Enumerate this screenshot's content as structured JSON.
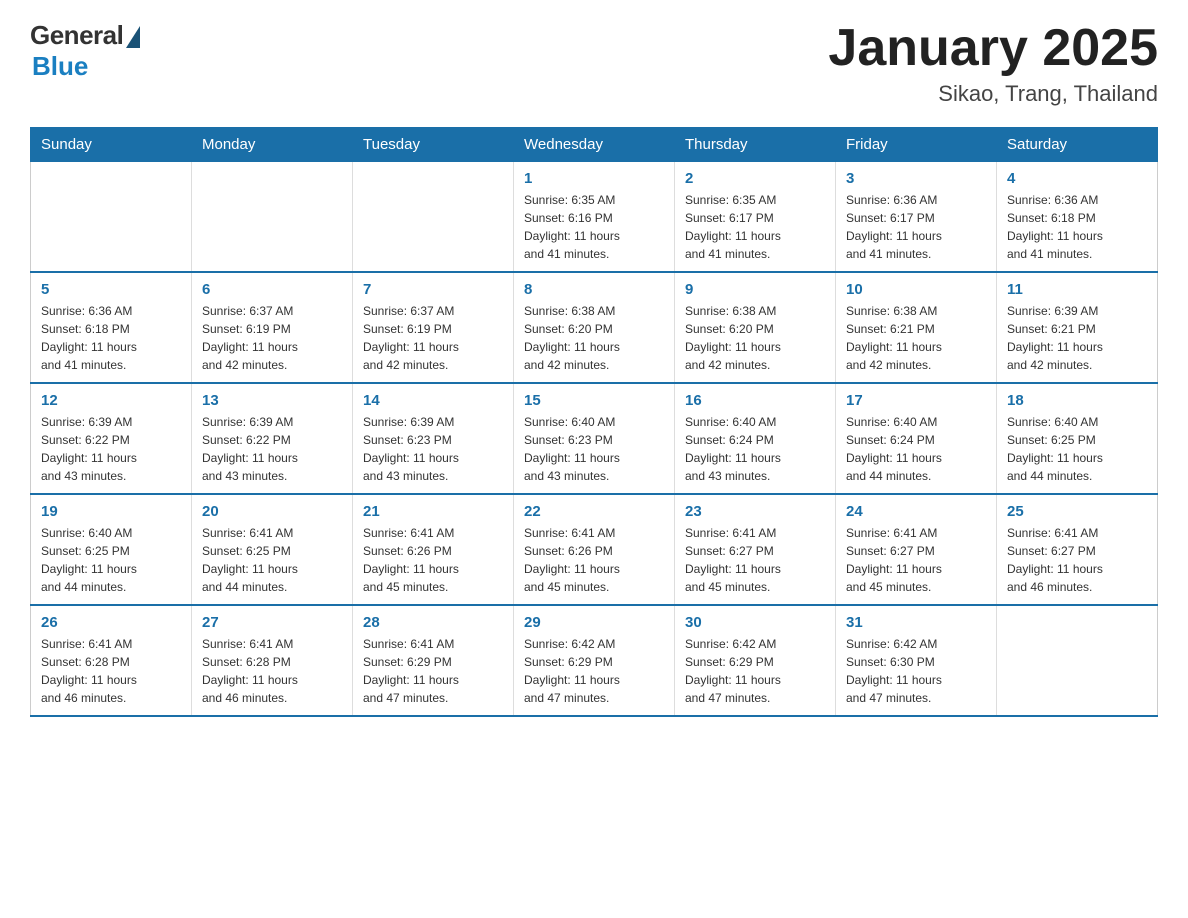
{
  "logo": {
    "general_text": "General",
    "blue_text": "Blue"
  },
  "title": {
    "month_year": "January 2025",
    "location": "Sikao, Trang, Thailand"
  },
  "days_of_week": [
    "Sunday",
    "Monday",
    "Tuesday",
    "Wednesday",
    "Thursday",
    "Friday",
    "Saturday"
  ],
  "weeks": [
    [
      {
        "day": "",
        "info": ""
      },
      {
        "day": "",
        "info": ""
      },
      {
        "day": "",
        "info": ""
      },
      {
        "day": "1",
        "info": "Sunrise: 6:35 AM\nSunset: 6:16 PM\nDaylight: 11 hours\nand 41 minutes."
      },
      {
        "day": "2",
        "info": "Sunrise: 6:35 AM\nSunset: 6:17 PM\nDaylight: 11 hours\nand 41 minutes."
      },
      {
        "day": "3",
        "info": "Sunrise: 6:36 AM\nSunset: 6:17 PM\nDaylight: 11 hours\nand 41 minutes."
      },
      {
        "day": "4",
        "info": "Sunrise: 6:36 AM\nSunset: 6:18 PM\nDaylight: 11 hours\nand 41 minutes."
      }
    ],
    [
      {
        "day": "5",
        "info": "Sunrise: 6:36 AM\nSunset: 6:18 PM\nDaylight: 11 hours\nand 41 minutes."
      },
      {
        "day": "6",
        "info": "Sunrise: 6:37 AM\nSunset: 6:19 PM\nDaylight: 11 hours\nand 42 minutes."
      },
      {
        "day": "7",
        "info": "Sunrise: 6:37 AM\nSunset: 6:19 PM\nDaylight: 11 hours\nand 42 minutes."
      },
      {
        "day": "8",
        "info": "Sunrise: 6:38 AM\nSunset: 6:20 PM\nDaylight: 11 hours\nand 42 minutes."
      },
      {
        "day": "9",
        "info": "Sunrise: 6:38 AM\nSunset: 6:20 PM\nDaylight: 11 hours\nand 42 minutes."
      },
      {
        "day": "10",
        "info": "Sunrise: 6:38 AM\nSunset: 6:21 PM\nDaylight: 11 hours\nand 42 minutes."
      },
      {
        "day": "11",
        "info": "Sunrise: 6:39 AM\nSunset: 6:21 PM\nDaylight: 11 hours\nand 42 minutes."
      }
    ],
    [
      {
        "day": "12",
        "info": "Sunrise: 6:39 AM\nSunset: 6:22 PM\nDaylight: 11 hours\nand 43 minutes."
      },
      {
        "day": "13",
        "info": "Sunrise: 6:39 AM\nSunset: 6:22 PM\nDaylight: 11 hours\nand 43 minutes."
      },
      {
        "day": "14",
        "info": "Sunrise: 6:39 AM\nSunset: 6:23 PM\nDaylight: 11 hours\nand 43 minutes."
      },
      {
        "day": "15",
        "info": "Sunrise: 6:40 AM\nSunset: 6:23 PM\nDaylight: 11 hours\nand 43 minutes."
      },
      {
        "day": "16",
        "info": "Sunrise: 6:40 AM\nSunset: 6:24 PM\nDaylight: 11 hours\nand 43 minutes."
      },
      {
        "day": "17",
        "info": "Sunrise: 6:40 AM\nSunset: 6:24 PM\nDaylight: 11 hours\nand 44 minutes."
      },
      {
        "day": "18",
        "info": "Sunrise: 6:40 AM\nSunset: 6:25 PM\nDaylight: 11 hours\nand 44 minutes."
      }
    ],
    [
      {
        "day": "19",
        "info": "Sunrise: 6:40 AM\nSunset: 6:25 PM\nDaylight: 11 hours\nand 44 minutes."
      },
      {
        "day": "20",
        "info": "Sunrise: 6:41 AM\nSunset: 6:25 PM\nDaylight: 11 hours\nand 44 minutes."
      },
      {
        "day": "21",
        "info": "Sunrise: 6:41 AM\nSunset: 6:26 PM\nDaylight: 11 hours\nand 45 minutes."
      },
      {
        "day": "22",
        "info": "Sunrise: 6:41 AM\nSunset: 6:26 PM\nDaylight: 11 hours\nand 45 minutes."
      },
      {
        "day": "23",
        "info": "Sunrise: 6:41 AM\nSunset: 6:27 PM\nDaylight: 11 hours\nand 45 minutes."
      },
      {
        "day": "24",
        "info": "Sunrise: 6:41 AM\nSunset: 6:27 PM\nDaylight: 11 hours\nand 45 minutes."
      },
      {
        "day": "25",
        "info": "Sunrise: 6:41 AM\nSunset: 6:27 PM\nDaylight: 11 hours\nand 46 minutes."
      }
    ],
    [
      {
        "day": "26",
        "info": "Sunrise: 6:41 AM\nSunset: 6:28 PM\nDaylight: 11 hours\nand 46 minutes."
      },
      {
        "day": "27",
        "info": "Sunrise: 6:41 AM\nSunset: 6:28 PM\nDaylight: 11 hours\nand 46 minutes."
      },
      {
        "day": "28",
        "info": "Sunrise: 6:41 AM\nSunset: 6:29 PM\nDaylight: 11 hours\nand 47 minutes."
      },
      {
        "day": "29",
        "info": "Sunrise: 6:42 AM\nSunset: 6:29 PM\nDaylight: 11 hours\nand 47 minutes."
      },
      {
        "day": "30",
        "info": "Sunrise: 6:42 AM\nSunset: 6:29 PM\nDaylight: 11 hours\nand 47 minutes."
      },
      {
        "day": "31",
        "info": "Sunrise: 6:42 AM\nSunset: 6:30 PM\nDaylight: 11 hours\nand 47 minutes."
      },
      {
        "day": "",
        "info": ""
      }
    ]
  ]
}
